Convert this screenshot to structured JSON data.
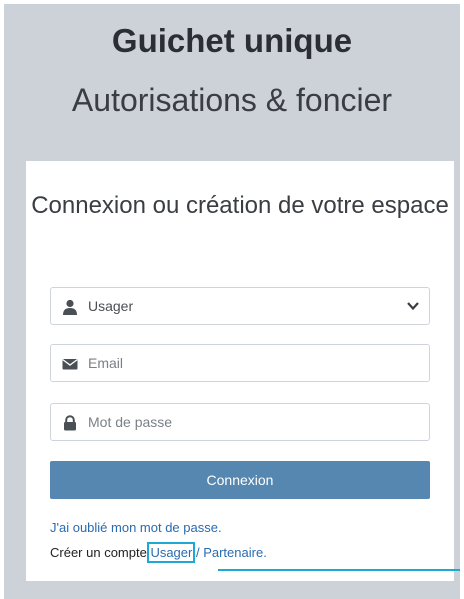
{
  "header": {
    "title": "Guichet unique",
    "subtitle": "Autorisations & foncier"
  },
  "login": {
    "heading": "Connexion ou création de votre espace",
    "profile_select": {
      "value": "Usager",
      "icon": "user-icon"
    },
    "email": {
      "placeholder": "Email",
      "icon": "envelope-icon"
    },
    "password": {
      "placeholder": "Mot de passe",
      "icon": "lock-icon"
    },
    "submit_label": "Connexion",
    "forgot_link": "J'ai oublié mon mot de passe.",
    "create_prefix": "Créer un compte ",
    "create_usager": "Usager",
    "create_separator": " / ",
    "create_partner": "Partenaire",
    "create_suffix": "."
  },
  "colors": {
    "page_background": "#cdd2d9",
    "button": "#5687b0",
    "link": "#2a6bb0",
    "highlight": "#1ca9d6"
  }
}
